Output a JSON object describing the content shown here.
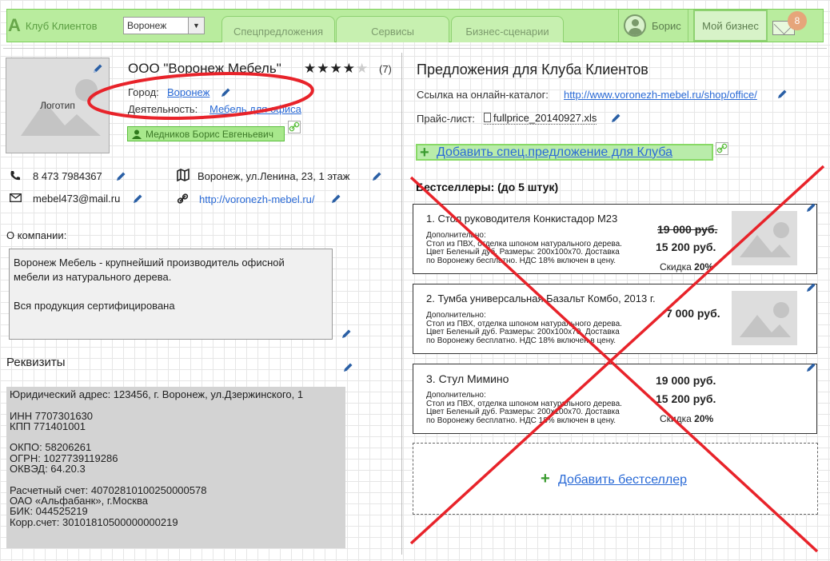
{
  "topbar": {
    "brand_label": "Клуб Клиентов",
    "city_select_value": "Воронеж",
    "tabs": [
      {
        "label": "Спецпредложения"
      },
      {
        "label": "Сервисы"
      },
      {
        "label": "Бизнес-сценарии"
      }
    ],
    "user_name": "Борис",
    "my_business_label": "Мой бизнес",
    "mail_badge": "8",
    "colors": {
      "bar": "#b9ec9e",
      "border": "#7ccf5a"
    }
  },
  "company": {
    "logo_label": "Логотип",
    "name": "ООО \"Воронеж Мебель\"",
    "rating": 4,
    "rating_max": 5,
    "votes": "(7)",
    "city_label": "Город:",
    "city_value": "Воронеж",
    "activity_label": "Деятельность:",
    "activity_value": "Мебель для офиса",
    "contact_person": "Медников Борис Евгеньевич",
    "phone": "8 473 7984367",
    "address": "Воронеж, ул.Ленина, 23, 1 этаж",
    "email": "mebel473@mail.ru",
    "website": "http://voronezh-mebel.ru/",
    "about_label": "О компании:",
    "about_lines": [
      "Воронеж Мебель - крупнейший производитель офисной",
      "мебели из натурального дерева.",
      "",
      "Вся продукция сертифицирована"
    ],
    "requisites_title": "Реквизиты",
    "requisites_text": "Юридический адрес: 123456, г. Воронеж, ул.Дзержинского, 1\n\nИНН 7707301630\nКПП 771401001\n\nОКПО: 58206261\nОГРН: 1027739119286\nОКВЭД: 64.20.3\n\nРасчетный счет: 40702810100250000578\nОАО «Альфабанк», г.Москва\nБИК: 044525219\nКорр.счет: 30101810500000000219"
  },
  "offers": {
    "title": "Предложения для Клуба Клиентов",
    "catalog_label": "Ссылка на онлайн-каталог:",
    "catalog_link": "http://www.voronezh-mebel.ru/shop/office/",
    "price_label": "Прайс-лист:",
    "price_file": "fullprice_20140927.xls",
    "add_offer_label": "Добавить спец.предложение для Клуба",
    "bestsellers_title": "Бестселлеры: (до 5 штук)",
    "bestsellers": [
      {
        "title": "1. Стол руководителя Конкистадор М23",
        "desc_lines": [
          "Дополнительно:",
          "Стол из ПВХ, отделка шпоном натурального дерева.",
          "Цвет Беленый дуб. Размеры: 200х100х70. Доставка",
          "по Воронежу бесплатно. НДС 18% включен в цену."
        ],
        "old_price": "19 000 руб.",
        "new_price": "15 200 руб.",
        "discount_label": "Скидка",
        "discount": "20%",
        "has_image": true
      },
      {
        "title": "2. Тумба универсальная Базальт Комбо, 2013 г.",
        "desc_lines": [
          "Дополнительно:",
          "Стол из ПВХ, отделка шпоном натурального дерева.",
          "Цвет Беленый дуб. Размеры: 200х100х70. Доставка",
          "по Воронежу бесплатно. НДС 18% включен в цену."
        ],
        "old_price": "",
        "new_price": "7 000 руб.",
        "discount_label": "",
        "discount": "",
        "has_image": true
      },
      {
        "title": "3. Стул Мимино",
        "desc_lines": [
          "Дополнительно:",
          "Стол из ПВХ, отделка шпоном натурального дерева.",
          "Цвет Беленый дуб. Размеры: 200х100х70. Доставка",
          "по Воронежу бесплатно. НДС 18% включен в цену."
        ],
        "old_price": "",
        "new_price": "19 000 руб.",
        "new_price_2": "15 200 руб.",
        "discount_label": "Скидка",
        "discount": "20%",
        "has_image": false
      }
    ],
    "add_bestseller_label": "Добавить бестселлер"
  },
  "annotations": {
    "color": "#e8232a"
  }
}
